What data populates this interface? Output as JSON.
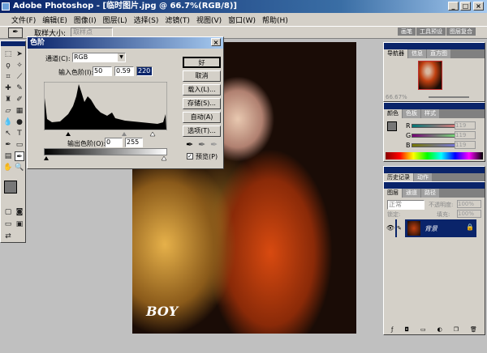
{
  "window": {
    "title": "Adobe Photoshop - [临时图片.jpg @ 66.7%(RGB/8)]"
  },
  "menu": [
    "文件(F)",
    "编辑(E)",
    "图像(I)",
    "图层(L)",
    "选择(S)",
    "滤镜(T)",
    "视图(V)",
    "窗口(W)",
    "帮助(H)"
  ],
  "options": {
    "sample_label": "取样大小:",
    "sample_value": "取样点"
  },
  "palette_well": {
    "tabs": [
      "画笔",
      "工具预设",
      "图层复合"
    ]
  },
  "levels": {
    "title": "色阶",
    "channel_label": "通道(C):",
    "channel": "RGB",
    "input_label": "输入色阶(I):",
    "input": [
      "50",
      "0.59",
      "220"
    ],
    "output_label": "输出色阶(O):",
    "output": [
      "0",
      "255"
    ],
    "buttons": [
      "好",
      "取消",
      "载入(L)...",
      "存储(S)...",
      "自动(A)",
      "选项(T)..."
    ],
    "preview_label": "预览(P)",
    "preview_checked": true
  },
  "navigator": {
    "tabs": [
      "导航器",
      "信息",
      "直方图"
    ],
    "zoom": "66.67%"
  },
  "color": {
    "tabs": [
      "颜色",
      "色板",
      "样式"
    ],
    "channels": [
      {
        "label": "R",
        "value": "119",
        "color": "#c04040"
      },
      {
        "label": "G",
        "value": "119",
        "color": "#40a040"
      },
      {
        "label": "B",
        "value": "119",
        "color": "#4040c0"
      }
    ]
  },
  "history": {
    "tabs": [
      "历史记录",
      "动作"
    ]
  },
  "layers": {
    "tabs": [
      "图层",
      "通道",
      "路径"
    ],
    "blend": "正常",
    "opacity_label": "不透明度:",
    "opacity": "100%",
    "lock_label": "锁定:",
    "fill_label": "填充:",
    "fill": "100%",
    "layer_name": "背景"
  },
  "photo": {
    "watermark": "BOY"
  }
}
